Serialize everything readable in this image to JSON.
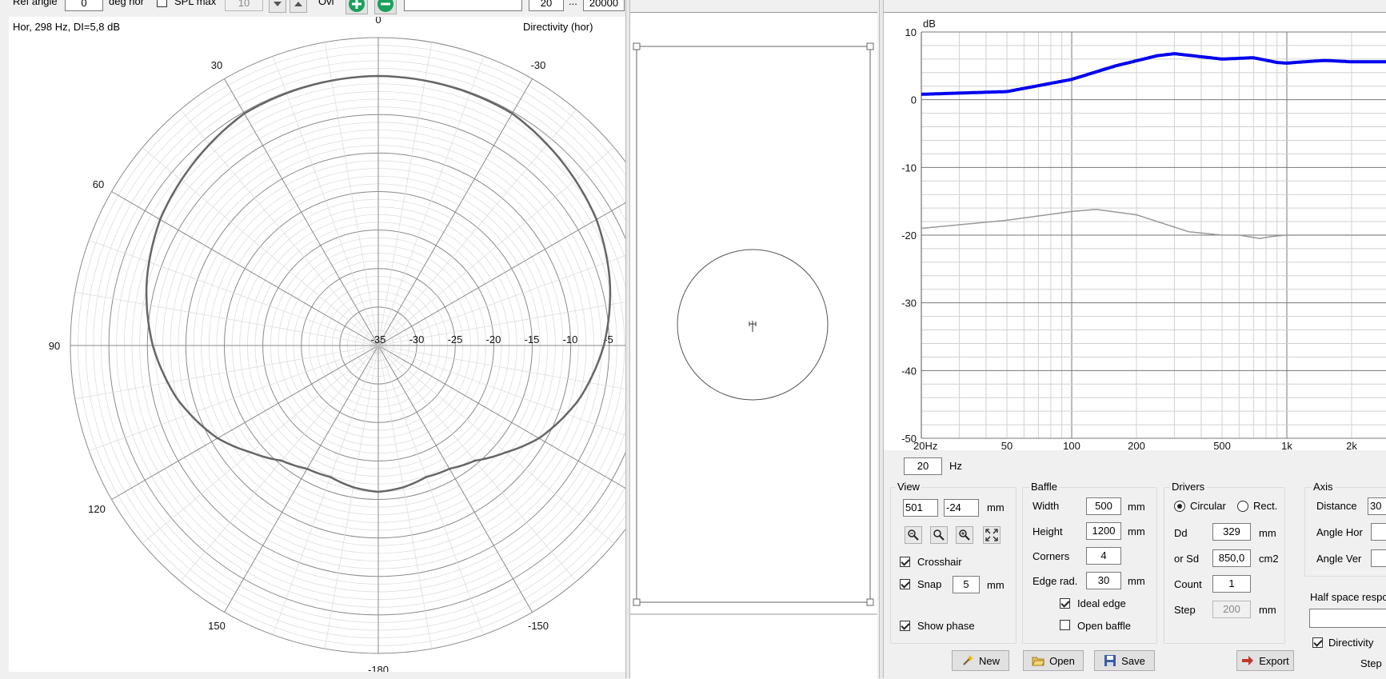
{
  "toolbar": {
    "ref_angle_label": "Ref angle",
    "ref_angle_value": "0",
    "deg_hor_label": "deg hor",
    "spl_max_label": "SPL max",
    "spl_max_value": "10",
    "ovl_label": "Ovl",
    "freq_min": "20",
    "ellipsis": "...",
    "freq_max": "20000"
  },
  "polar": {
    "info_text": "Hor, 298 Hz, DI=5,8 dB",
    "title": "Directivity (hor)",
    "angle_labels": [
      "0",
      "30",
      "-30",
      "60",
      "90",
      "120",
      "150",
      "-150",
      "-180"
    ],
    "radial_labels": [
      "-35",
      "-30",
      "-25",
      "-20",
      "-15",
      "-10",
      "-5"
    ],
    "response_color": "#666666"
  },
  "freq_chart": {
    "ylabel": "dB",
    "y_ticks": [
      "10",
      "0",
      "-10",
      "-20",
      "-30",
      "-40",
      "-50"
    ],
    "x_ticks": [
      "20Hz",
      "50",
      "100",
      "200",
      "500",
      "1k",
      "2k"
    ],
    "series_main_color": "#0000ee",
    "series_second_color": "#999999"
  },
  "hz_input": {
    "value": "20",
    "unit": "Hz"
  },
  "view": {
    "title": "View",
    "x_value": "501",
    "y_value": "-24",
    "unit": "mm",
    "crosshair_label": "Crosshair",
    "snap_label": "Snap",
    "snap_value": "5",
    "snap_unit": "mm",
    "show_phase_label": "Show phase"
  },
  "baffle": {
    "title": "Baffle",
    "width_label": "Width",
    "width_value": "500",
    "width_unit": "mm",
    "height_label": "Height",
    "height_value": "1200",
    "height_unit": "mm",
    "corners_label": "Corners",
    "corners_value": "4",
    "edge_label": "Edge rad.",
    "edge_value": "30",
    "edge_unit": "mm",
    "ideal_edge_label": "Ideal edge",
    "open_baffle_label": "Open baffle"
  },
  "drivers": {
    "title": "Drivers",
    "circular_label": "Circular",
    "rect_label": "Rect.",
    "dd_label": "Dd",
    "dd_value": "329",
    "dd_unit": "mm",
    "sd_label": "or Sd",
    "sd_value": "850,0",
    "sd_unit": "cm2",
    "count_label": "Count",
    "count_value": "1",
    "step_label": "Step",
    "step_value": "200",
    "step_unit": "mm"
  },
  "axis": {
    "title": "Axis",
    "distance_label": "Distance",
    "distance_value": "30",
    "angle_hor_label": "Angle Hor",
    "angle_ver_label": "Angle Ver",
    "half_space_label": "Half space respo",
    "directivity_label": "Directivity",
    "step_label": "Step"
  },
  "buttons": {
    "new_label": "New",
    "open_label": "Open",
    "save_label": "Save",
    "export_label": "Export"
  }
}
